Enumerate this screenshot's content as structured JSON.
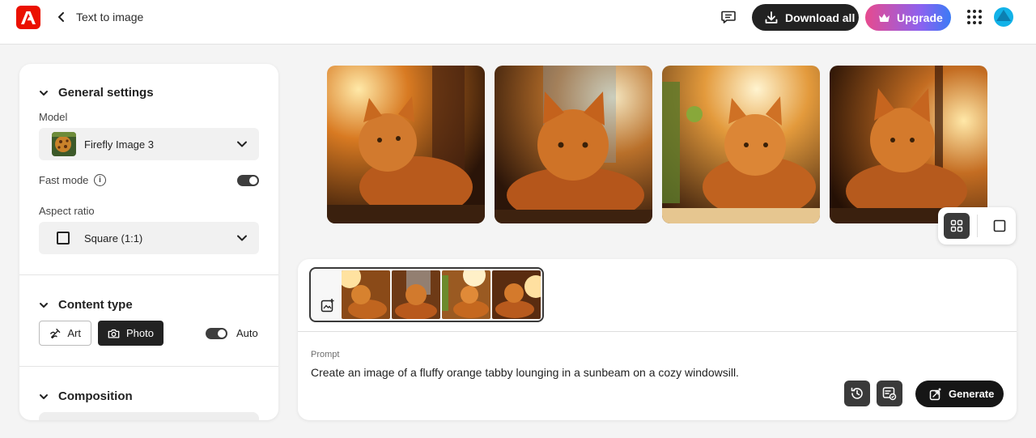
{
  "header": {
    "logo_icon": "adobe-logo-icon",
    "back_icon": "chevron-left-icon",
    "title": "Text to image",
    "feedback_icon": "chat-icon",
    "download_all_label": "Download all",
    "upgrade_label": "Upgrade",
    "apps_icon": "grid-dots-icon",
    "brand_color": "#eb1000"
  },
  "settings": {
    "general": {
      "heading": "General settings",
      "model_label": "Model",
      "model_value": "Firefly Image 3",
      "fast_mode_label": "Fast mode",
      "fast_mode_on": true,
      "aspect_ratio_label": "Aspect ratio",
      "aspect_ratio_value": "Square (1:1)"
    },
    "content_type": {
      "heading": "Content type",
      "options": [
        "Art",
        "Photo"
      ],
      "selected": "Photo",
      "auto_label": "Auto",
      "auto_on": true
    },
    "composition": {
      "heading": "Composition"
    }
  },
  "results": {
    "image_count": 4,
    "view_modes": [
      "grid",
      "single"
    ],
    "active_view": "grid"
  },
  "prompt_card": {
    "thumbnail_count": 4,
    "prompt_label": "Prompt",
    "prompt_text": "Create an image of a fluffy orange tabby lounging in a sunbeam on a cozy windowsill.",
    "history_icon": "history-icon",
    "reference_icon": "image-reference-icon",
    "generate_label": "Generate"
  }
}
